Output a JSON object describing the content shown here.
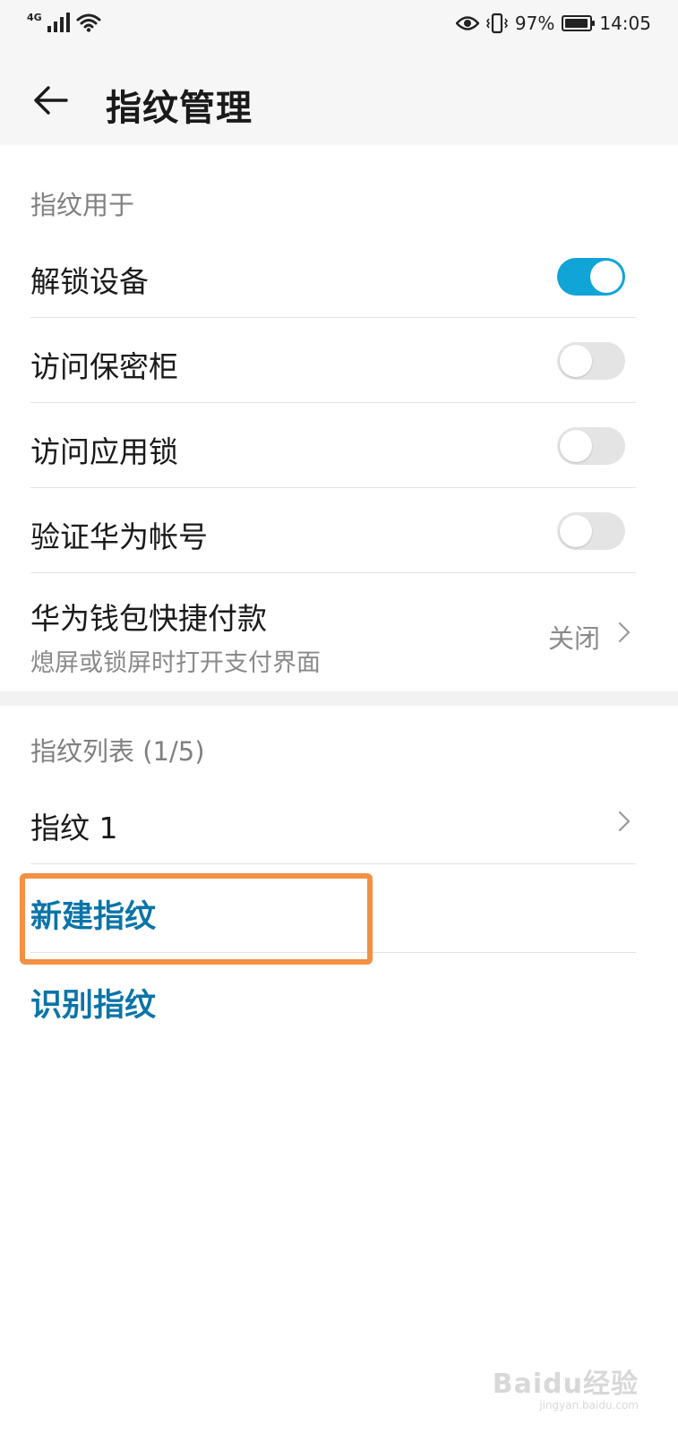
{
  "status_bar": {
    "network": "4G",
    "battery_percent": "97%",
    "battery_level": 0.97,
    "time": "14:05",
    "icons": [
      "signal-icon",
      "wifi-icon",
      "eye-comfort-icon",
      "vibrate-icon",
      "battery-icon"
    ]
  },
  "header": {
    "title": "指纹管理",
    "back_icon": "arrow-left-icon"
  },
  "usage_section": {
    "title": "指纹用于",
    "items": [
      {
        "label": "解锁设备",
        "enabled": true
      },
      {
        "label": "访问保密柜",
        "enabled": false
      },
      {
        "label": "访问应用锁",
        "enabled": false
      },
      {
        "label": "验证华为帐号",
        "enabled": false
      }
    ],
    "payment": {
      "label": "华为钱包快捷付款",
      "subtitle": "熄屏或锁屏时打开支付界面",
      "value": "关闭"
    }
  },
  "list_section": {
    "title": "指纹列表 (1/5)",
    "fingerprints": [
      {
        "label": "指纹 1"
      }
    ],
    "new_fingerprint": "新建指纹",
    "identify_fingerprint": "识别指纹"
  },
  "colors": {
    "toggle_on": "#11a4d6",
    "toggle_off": "#e4e4e4",
    "link": "#0a74a8",
    "highlight": "#f39042"
  },
  "watermark": {
    "brand": "Baidu经验",
    "url": "jingyan.baidu.com"
  }
}
